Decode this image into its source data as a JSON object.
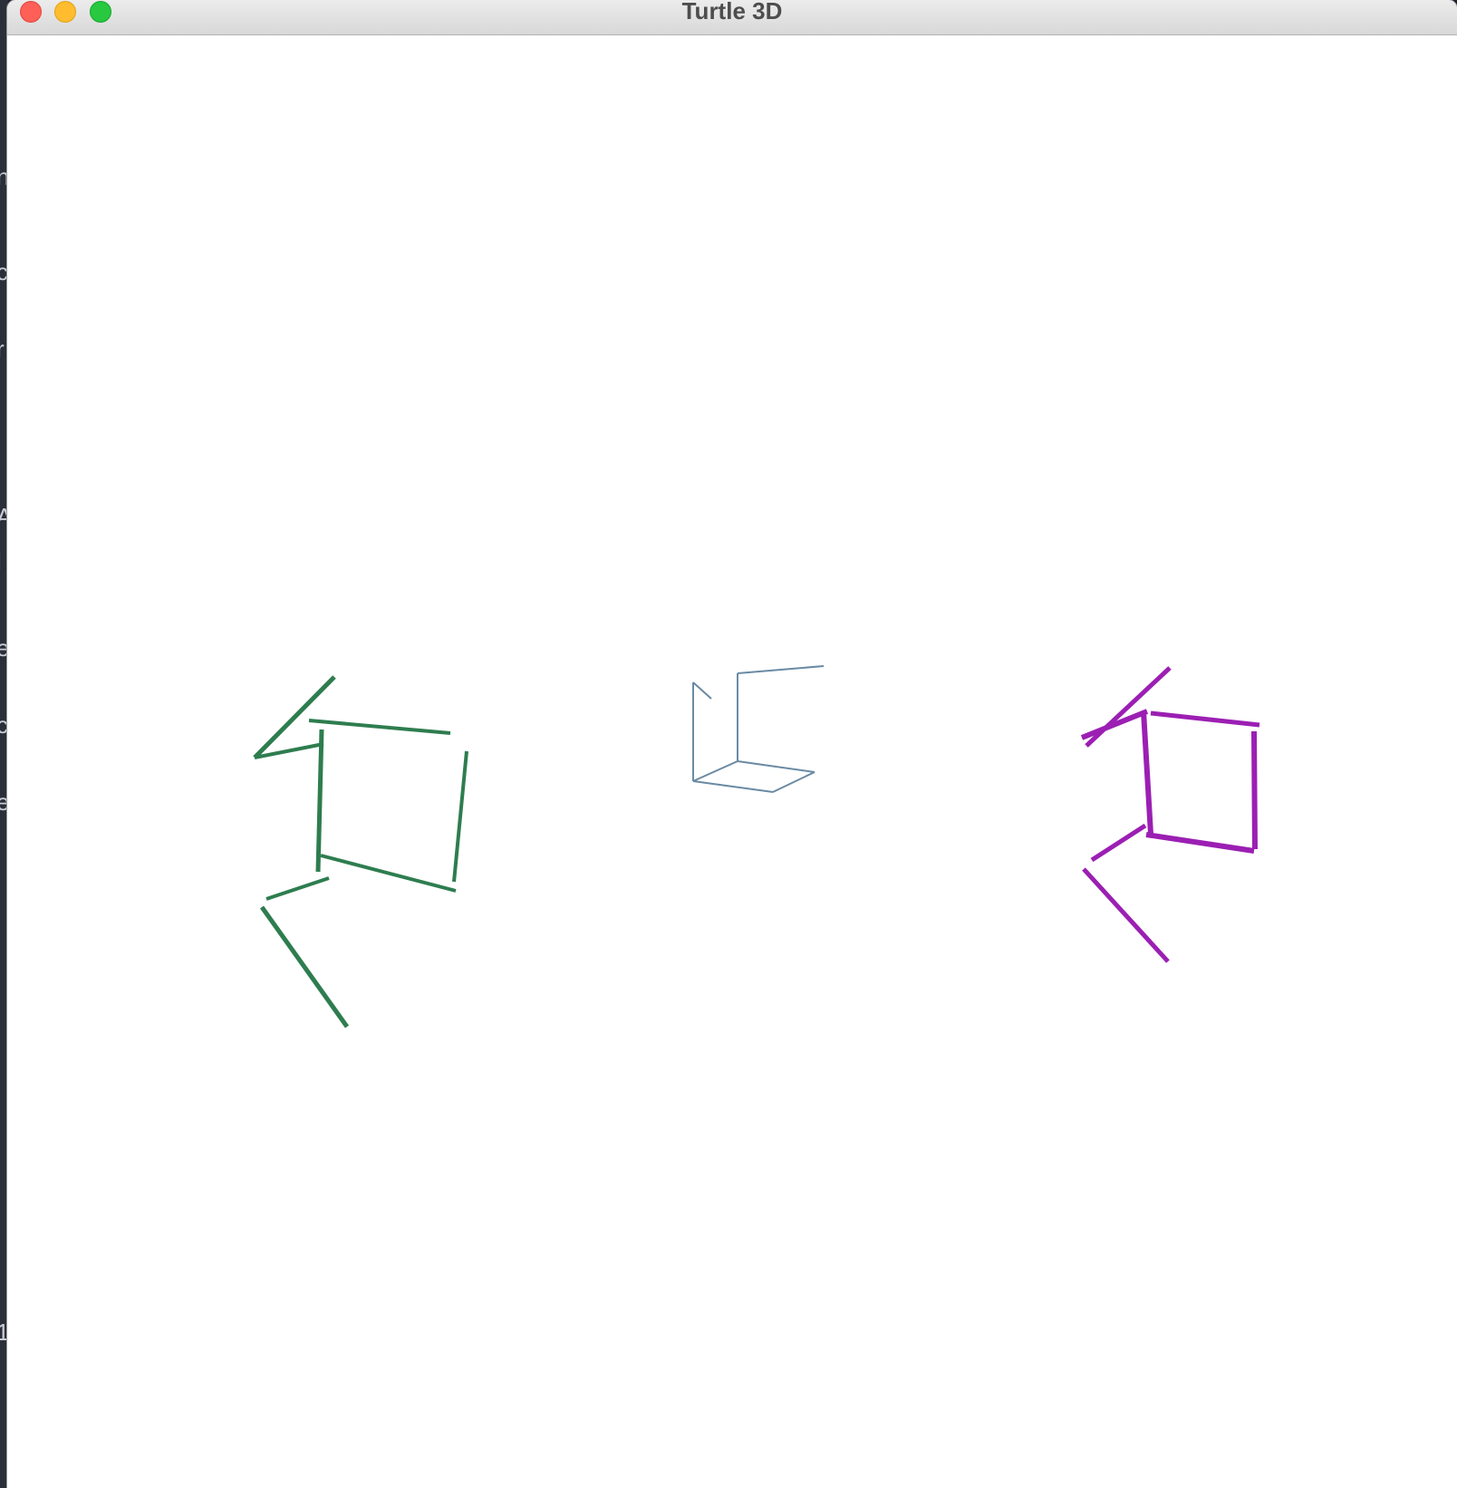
{
  "window": {
    "title": "Turtle 3D"
  },
  "colors": {
    "left_figure": "#2e7d4f",
    "center_figure": "#6a8aa3",
    "right_figure": "#9b1fb3"
  },
  "figures": [
    {
      "name": "left-figure",
      "color_key": "left_figure"
    },
    {
      "name": "center-figure",
      "color_key": "center_figure"
    },
    {
      "name": "right-figure",
      "color_key": "right_figure"
    }
  ],
  "icons": [
    "close-icon",
    "minimize-icon",
    "zoom-icon"
  ]
}
